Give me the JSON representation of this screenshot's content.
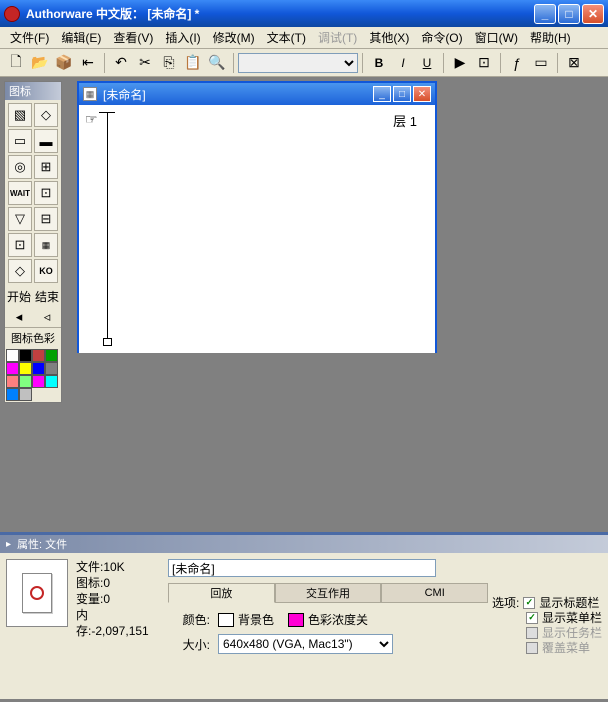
{
  "title": "Authorware 中文版： [未命名] *",
  "menu": {
    "file": "文件(F)",
    "edit": "编辑(E)",
    "view": "查看(V)",
    "insert": "插入(I)",
    "modify": "修改(M)",
    "text": "文本(T)",
    "debug": "调试(T)",
    "extras": "其他(X)",
    "commands": "命令(O)",
    "window": "窗口(W)",
    "help": "帮助(H)"
  },
  "iconpanel": {
    "title": "图标",
    "start": "开始",
    "end": "结束",
    "color": "图标色彩"
  },
  "colors": [
    "#ffffff",
    "#000000",
    "#c04040",
    "#00a000",
    "#ff00ff",
    "#ffff00",
    "#0000ff",
    "#808080",
    "#ff8080",
    "#80ff80",
    "#ff00ff",
    "#00ffff",
    "#0080ff",
    "#c0c0c0"
  ],
  "doc": {
    "title": "[未命名]",
    "layer": "层 1"
  },
  "properties": {
    "title": "属性: 文件",
    "fileLabel": "文件:10K",
    "iconLabel": "图标:0",
    "varLabel": "变量:0",
    "memLabel": "内存:-2,097,151",
    "name": "[未命名]",
    "tabs": {
      "playback": "回放",
      "interaction": "交互作用",
      "cmi": "CMI"
    },
    "colorLabel": "颜色:",
    "bgLabel": "背景色",
    "chromaLabel": "色彩浓度关",
    "sizeLabel": "大小:",
    "sizeValue": "640x480 (VGA, Mac13\")",
    "optionsLabel": "选项:",
    "opt1": "显示标题栏",
    "opt2": "显示菜单栏",
    "opt3": "显示任务栏",
    "opt4": "覆盖菜单"
  }
}
